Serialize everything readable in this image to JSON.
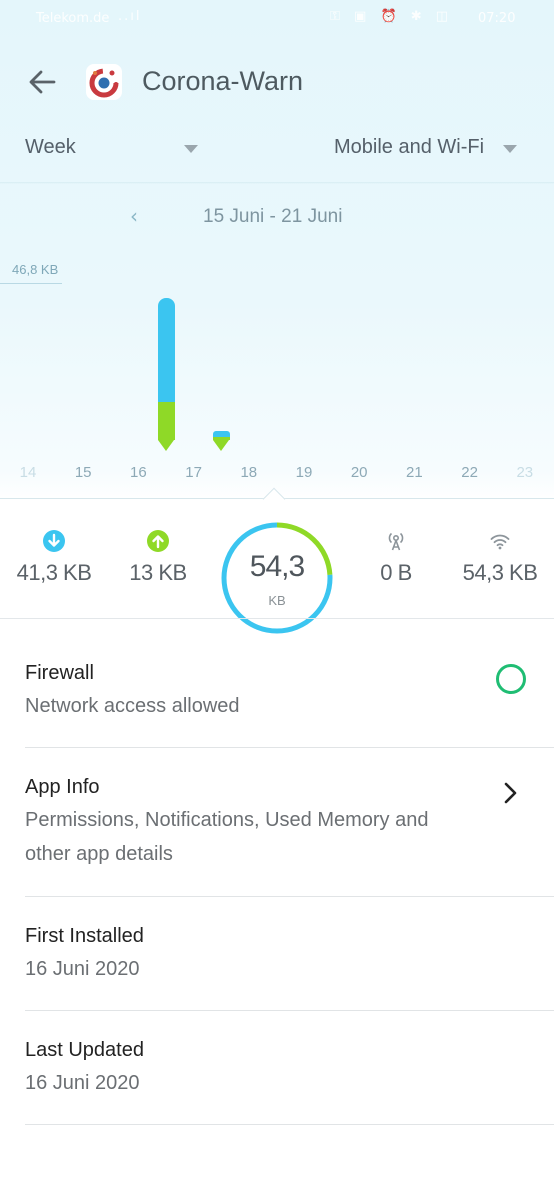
{
  "status_bar": {
    "carrier": "Telekom.de",
    "signal": "..ıl",
    "icons": "⚿ ▣ ⏰ ✱ ◫",
    "time": "07:20"
  },
  "header": {
    "back_icon": "arrow-left-icon",
    "app_icon": "corona-warn-app-icon",
    "title": "Corona-Warn"
  },
  "filters": {
    "period": "Week",
    "network": "Mobile and Wi-Fi"
  },
  "date_nav": {
    "prev": "‹",
    "range": "15 Juni - 21 Juni"
  },
  "chart_data": {
    "type": "bar",
    "max_label": "46,8 KB",
    "ylim": [
      0,
      46.8
    ],
    "categories": [
      "14",
      "15",
      "16",
      "17",
      "18",
      "19",
      "20",
      "21",
      "22",
      "23"
    ],
    "series": [
      {
        "name": "download",
        "color": "#3bc5f0",
        "values": [
          0,
          0,
          32.8,
          2.0,
          0,
          0,
          0,
          0,
          0,
          0
        ]
      },
      {
        "name": "upload",
        "color": "#8fd927",
        "values": [
          0,
          0,
          12.0,
          1.0,
          0,
          0,
          0,
          0,
          0,
          0
        ]
      }
    ],
    "bar_days": [
      "16",
      "17"
    ]
  },
  "stats": {
    "download": {
      "icon": "download-icon",
      "value": "41,3 KB",
      "color": "#3bc5f0"
    },
    "upload": {
      "icon": "upload-icon",
      "value": "13 KB",
      "color": "#8fd927"
    },
    "total": {
      "value": "54,3",
      "unit": "KB",
      "download_fraction": 0.76
    },
    "mobile": {
      "icon": "cell-tower-icon",
      "value": "0 B"
    },
    "wifi": {
      "icon": "wifi-icon",
      "value": "54,3 KB"
    }
  },
  "sections": {
    "firewall": {
      "title": "Firewall",
      "subtitle": "Network access allowed",
      "enabled": true
    },
    "app_info": {
      "title": "App Info",
      "subtitle": "Permissions, Notifications, Used Memory and other app details"
    },
    "first_installed": {
      "title": "First Installed",
      "value": "16 Juni 2020"
    },
    "last_updated": {
      "title": "Last Updated",
      "value": "16 Juni 2020"
    }
  }
}
